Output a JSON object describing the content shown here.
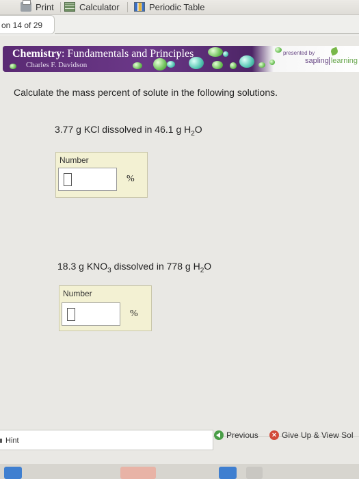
{
  "toolbar": {
    "print_label": "Print",
    "calculator_label": "Calculator",
    "periodic_table_label": "Periodic Table"
  },
  "question_counter": "on 14 of 29",
  "banner": {
    "title_bold": "Chemistry",
    "title_rest": ": Fundamentals and Principles",
    "author": "Charles F. Davidson",
    "presented_by": "presented by",
    "brand_sapling": "sapling",
    "brand_learning": "learning"
  },
  "instruction": "Calculate the mass percent of solute in the following solutions.",
  "problems": [
    {
      "pre": "3.77 g KCl dissolved in 46.1 g H",
      "sub": "2",
      "post": "O",
      "answer_label": "Number",
      "answer_value": "",
      "unit": "%"
    },
    {
      "pre": "18.3 g KNO",
      "sub": "3",
      "mid": " dissolved in 778 g H",
      "sub2": "2",
      "post": "O",
      "answer_label": "Number",
      "answer_value": "",
      "unit": "%"
    }
  ],
  "footer": {
    "hint_label": "Hint",
    "previous_label": "Previous",
    "give_up_label": "Give Up & View Sol"
  },
  "colors": {
    "banner_purple": "#5a2a73",
    "answer_box_bg": "#f3f1d3",
    "previous_green": "#4a9e47",
    "give_up_red": "#d24b3a"
  }
}
